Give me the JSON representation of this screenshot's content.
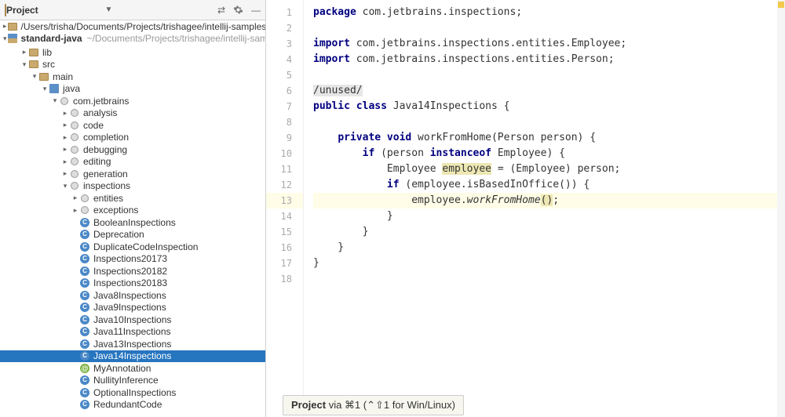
{
  "sidebar": {
    "title": "Project",
    "path_row": "/Users/trisha/Documents/Projects/trishagee/intellij-samples/spri",
    "module_name": "standard-java",
    "module_hint": "~/Documents/Projects/trishagee/intellij-samples…"
  },
  "tree": [
    {
      "depth": 2,
      "arrow": "▸",
      "icon": "folder",
      "label": "lib"
    },
    {
      "depth": 2,
      "arrow": "▾",
      "icon": "folder",
      "label": "src"
    },
    {
      "depth": 3,
      "arrow": "▾",
      "icon": "folder",
      "label": "main"
    },
    {
      "depth": 4,
      "arrow": "▾",
      "icon": "module",
      "label": "java"
    },
    {
      "depth": 5,
      "arrow": "▾",
      "icon": "pkg",
      "label": "com.jetbrains"
    },
    {
      "depth": 6,
      "arrow": "▸",
      "icon": "pkg",
      "label": "analysis"
    },
    {
      "depth": 6,
      "arrow": "▸",
      "icon": "pkg",
      "label": "code"
    },
    {
      "depth": 6,
      "arrow": "▸",
      "icon": "pkg",
      "label": "completion"
    },
    {
      "depth": 6,
      "arrow": "▸",
      "icon": "pkg",
      "label": "debugging"
    },
    {
      "depth": 6,
      "arrow": "▸",
      "icon": "pkg",
      "label": "editing"
    },
    {
      "depth": 6,
      "arrow": "▸",
      "icon": "pkg",
      "label": "generation"
    },
    {
      "depth": 6,
      "arrow": "▾",
      "icon": "pkg",
      "label": "inspections"
    },
    {
      "depth": 7,
      "arrow": "▸",
      "icon": "pkg",
      "label": "entities"
    },
    {
      "depth": 7,
      "arrow": "▸",
      "icon": "pkg",
      "label": "exceptions"
    },
    {
      "depth": 7,
      "arrow": "",
      "icon": "class",
      "label": "BooleanInspections"
    },
    {
      "depth": 7,
      "arrow": "",
      "icon": "class",
      "label": "Deprecation"
    },
    {
      "depth": 7,
      "arrow": "",
      "icon": "class",
      "label": "DuplicateCodeInspection"
    },
    {
      "depth": 7,
      "arrow": "",
      "icon": "class",
      "label": "Inspections20173"
    },
    {
      "depth": 7,
      "arrow": "",
      "icon": "class",
      "label": "Inspections20182"
    },
    {
      "depth": 7,
      "arrow": "",
      "icon": "class",
      "label": "Inspections20183"
    },
    {
      "depth": 7,
      "arrow": "",
      "icon": "class",
      "label": "Java8Inspections"
    },
    {
      "depth": 7,
      "arrow": "",
      "icon": "class",
      "label": "Java9Inspections"
    },
    {
      "depth": 7,
      "arrow": "",
      "icon": "class",
      "label": "Java10Inspections"
    },
    {
      "depth": 7,
      "arrow": "",
      "icon": "class",
      "label": "Java11Inspections"
    },
    {
      "depth": 7,
      "arrow": "",
      "icon": "class",
      "label": "Java13Inspections"
    },
    {
      "depth": 7,
      "arrow": "",
      "icon": "class",
      "label": "Java14Inspections",
      "selected": true
    },
    {
      "depth": 7,
      "arrow": "",
      "icon": "ann",
      "label": "MyAnnotation"
    },
    {
      "depth": 7,
      "arrow": "",
      "icon": "class",
      "label": "NullityInference"
    },
    {
      "depth": 7,
      "arrow": "",
      "icon": "class",
      "label": "OptionalInspections"
    },
    {
      "depth": 7,
      "arrow": "",
      "icon": "class",
      "label": "RedundantCode"
    }
  ],
  "code": {
    "lines": [
      {
        "n": 1,
        "html": "<span class='kw'>package</span> com.jetbrains.inspections;"
      },
      {
        "n": 2,
        "html": ""
      },
      {
        "n": 3,
        "html": "<span class='kw'>import</span> com.jetbrains.inspections.entities.Employee;"
      },
      {
        "n": 4,
        "html": "<span class='kw'>import</span> com.jetbrains.inspections.entities.Person;"
      },
      {
        "n": 5,
        "html": ""
      },
      {
        "n": 6,
        "html": "<span class='anno'>/unused/</span>"
      },
      {
        "n": 7,
        "html": "<span class='kw'>public class</span> Java14Inspections {"
      },
      {
        "n": 8,
        "html": ""
      },
      {
        "n": 9,
        "html": "    <span class='kw'>private void</span> workFromHome(Person person) {"
      },
      {
        "n": 10,
        "html": "        <span class='kw'>if</span> (person <span class='kw'>instanceof</span> Employee) {"
      },
      {
        "n": 11,
        "html": "            Employee <span class='hl'>employee</span> = (Employee) person;"
      },
      {
        "n": 12,
        "html": "            <span class='kw'>if</span> (employee.isBasedInOffice()) {"
      },
      {
        "n": 13,
        "html": "                employee.<span class='meth'>workFromHome</span><span class='hl'>()</span>;",
        "current": true
      },
      {
        "n": 14,
        "html": "            }"
      },
      {
        "n": 15,
        "html": "        }"
      },
      {
        "n": 16,
        "html": "    }"
      },
      {
        "n": 17,
        "html": "}"
      },
      {
        "n": 18,
        "html": ""
      }
    ]
  },
  "tip": "Project via ⌘1 (⌃⇧1 for Win/Linux)"
}
